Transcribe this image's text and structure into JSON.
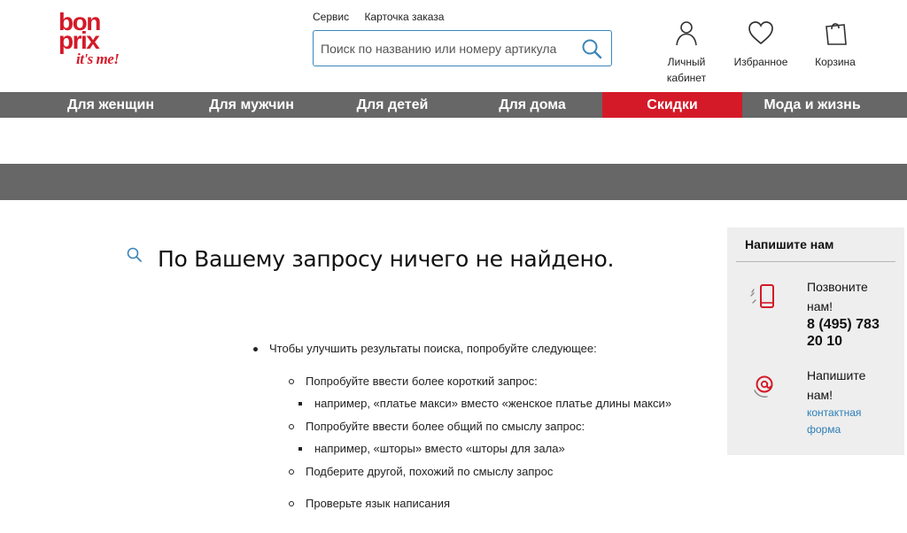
{
  "logo": {
    "line1": "bon",
    "line2": "prix",
    "tagline": "it's me!"
  },
  "toplinks": [
    {
      "label": "Сервис"
    },
    {
      "label": "Карточка заказа"
    }
  ],
  "search": {
    "placeholder": "Поиск по названию или номеру артикула"
  },
  "header_icons": {
    "account": {
      "label_line1": "Личный",
      "label_line2": "кабинет",
      "icon": "user-icon"
    },
    "favorites": {
      "label": "Избранное",
      "icon": "heart-icon"
    },
    "cart": {
      "label": "Корзина",
      "icon": "shopping-bag-icon"
    }
  },
  "nav": [
    {
      "label": "Для женщин"
    },
    {
      "label": "Для мужчин"
    },
    {
      "label": "Для детей"
    },
    {
      "label": "Для дома"
    },
    {
      "label": "Скидки"
    },
    {
      "label": "Мода и жизнь"
    }
  ],
  "main": {
    "no_results": "По Вашему запросу  ничего не найдено.",
    "tips_intro": "Чтобы улучшить результаты поиска, попробуйте следующее:",
    "tip1": "Попробуйте ввести более короткий запрос:",
    "tip1_example": "например, «платье макси» вместо «женское платье длины макси»",
    "tip2": "Попробуйте ввести более общий по смыслу запрос:",
    "tip2_example": "например, «шторы» вместо «шторы для зала»",
    "tip3": "Подберите другой, похожий по смыслу запрос",
    "tip4": "Проверьте язык написания"
  },
  "contact": {
    "title": "Напишите нам",
    "call_line1": "Позвоните",
    "call_line2": "нам!",
    "phone_line1": "8 (495) 783",
    "phone_line2": "20 10",
    "write_line1": "Напишите",
    "write_line2": "нам!",
    "form_line1": "контактная",
    "form_line2": "форма"
  },
  "colors": {
    "brand_red": "#d41a28",
    "nav_gray": "#676767",
    "link_blue": "#2d7fb8",
    "sidebar_bg": "#eeeeee"
  }
}
